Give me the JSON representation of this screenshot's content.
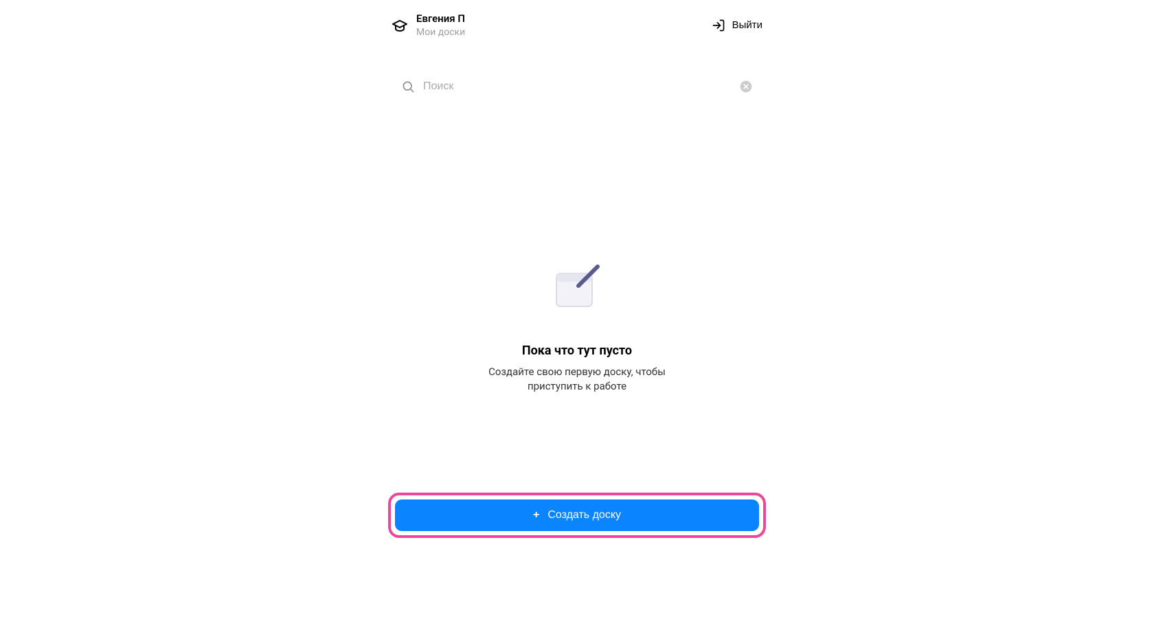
{
  "header": {
    "user_name": "Евгения П",
    "user_subtitle": "Мои доски",
    "logout_label": "Выйти"
  },
  "search": {
    "placeholder": "Поиск"
  },
  "empty_state": {
    "title": "Пока что тут пусто",
    "subtitle": "Создайте свою первую доску, чтобы приступить к работе"
  },
  "create_button": {
    "label": "Создать доску"
  }
}
